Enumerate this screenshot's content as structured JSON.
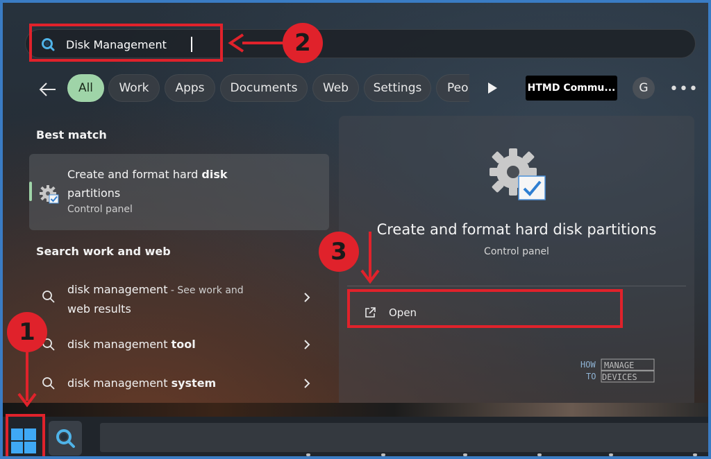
{
  "search": {
    "value": "Disk Management"
  },
  "filters": {
    "chips": [
      "All",
      "Work",
      "Apps",
      "Documents",
      "Web",
      "Settings",
      "Peo"
    ],
    "community": "HTMD Commu...",
    "avatar_initial": "G",
    "more": "•••"
  },
  "best_match": {
    "heading": "Best match",
    "title_pre": "Create and format hard ",
    "title_bold": "disk",
    "title_post": "partitions",
    "subtitle": "Control panel"
  },
  "search_web": {
    "heading": "Search work and web",
    "items": [
      {
        "pre": "disk management",
        "bold": "",
        "suffix": " - See work and",
        "suffix2": "web results"
      },
      {
        "pre": "disk management ",
        "bold": "tool"
      },
      {
        "pre": "disk management ",
        "bold": "system"
      }
    ]
  },
  "preview": {
    "title": "Create and format hard disk partitions",
    "subtitle": "Control panel",
    "open_label": "Open"
  },
  "annotations": {
    "one": "1",
    "two": "2",
    "three": "3"
  },
  "logo": {
    "line1": "HOW",
    "line2": "TO",
    "word1": "MANAGE",
    "word2": "DEVICES"
  },
  "colors": {
    "annotation": "#e0222b",
    "accent": "#9fd4a8",
    "search_icon": "#4fb3e8"
  },
  "icons": [
    "search-icon",
    "back-arrow-icon",
    "play-icon",
    "gear-icon",
    "chevron-right-icon",
    "open-external-icon",
    "windows-start-icon"
  ]
}
